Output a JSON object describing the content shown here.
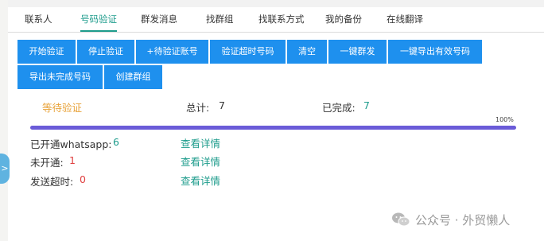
{
  "tabs": [
    {
      "label": "联系人"
    },
    {
      "label": "号码验证"
    },
    {
      "label": "群发消息"
    },
    {
      "label": "找群组"
    },
    {
      "label": "找联系方式"
    },
    {
      "label": "我的备份"
    },
    {
      "label": "在线翻译"
    }
  ],
  "active_tab": "号码验证",
  "toolbar": {
    "start_verify": "开始验证",
    "stop_verify": "停止验证",
    "add_pending": "+待验证账号",
    "verify_timeout": "验证超时号码",
    "clear": "清空",
    "one_click_broadcast": "一键群发",
    "export_valid": "一键导出有效号码",
    "export_unfinished": "导出未完成号码",
    "create_group": "创建群组"
  },
  "status": {
    "state": "等待验证",
    "total_label": "总计:",
    "total_value": "7",
    "done_label": "已完成:",
    "done_value": "7",
    "progress_percent": "100%",
    "progress_fraction": 1.0
  },
  "results": [
    {
      "label": "已开通whatsapp:",
      "value": "6",
      "link": "查看详情"
    },
    {
      "label": "未开通:",
      "value": "1",
      "link": "查看详情"
    },
    {
      "label": "发送超时:",
      "value": "0",
      "link": "查看详情"
    }
  ],
  "side_handle": {
    "icon": "chevron-right-icon",
    "glyph": ">"
  },
  "watermark": {
    "text": "公众号 · 外贸懒人",
    "icon": "wechat-icon"
  },
  "colors": {
    "accent": "#1e9c8c",
    "button": "#1e90ee",
    "progress": "#6a5bd8",
    "pending": "#e8a33a",
    "error": "#e04040"
  }
}
